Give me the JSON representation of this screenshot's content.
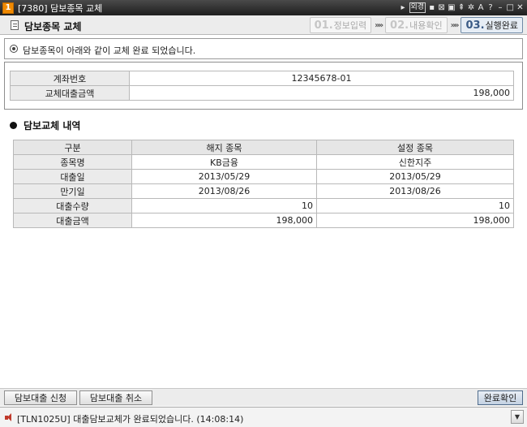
{
  "window": {
    "number": "1",
    "title": "[7380] 담보종목 교체",
    "icons": [
      "arrow-right-icon",
      "lock-label",
      "memo-icon",
      "close-box-icon",
      "window-icon",
      "pin-icon",
      "settings-icon",
      "font-icon",
      "help-icon",
      "minimize-icon",
      "maximize-icon",
      "close-icon"
    ],
    "lock_label": "외경",
    "font_label": "A",
    "help_label": "?"
  },
  "header": {
    "title": "담보종목 교체",
    "steps": [
      {
        "num": "01.",
        "label": "정보입력",
        "active": false
      },
      {
        "num": "02.",
        "label": "내용확인",
        "active": false
      },
      {
        "num": "03.",
        "label": "실행완료",
        "active": true
      }
    ],
    "separator": "»»"
  },
  "message": "담보종목이 아래와 같이 교체 완료 되었습니다.",
  "account": {
    "account_label": "계좌번호",
    "account_value": "12345678-01",
    "amount_label": "교체대출금액",
    "amount_value": "198,000"
  },
  "section_title": "담보교체 내역",
  "details": {
    "columns": [
      "구분",
      "해지 종목",
      "설정 종목"
    ],
    "rows": [
      {
        "label": "종목명",
        "cancel": "KB금융",
        "set": "신한지주",
        "align": "c"
      },
      {
        "label": "대출일",
        "cancel": "2013/05/29",
        "set": "2013/05/29",
        "align": "c"
      },
      {
        "label": "만기일",
        "cancel": "2013/08/26",
        "set": "2013/08/26",
        "align": "c"
      },
      {
        "label": "대출수량",
        "cancel": "10",
        "set": "10",
        "align": "r"
      },
      {
        "label": "대출금액",
        "cancel": "198,000",
        "set": "198,000",
        "align": "r"
      }
    ]
  },
  "buttons": {
    "apply": "담보대출 신청",
    "cancel": "담보대출 취소",
    "confirm": "완료확인"
  },
  "status": "[TLN1025U] 대출담보교체가 완료되었습니다. (14:08:14)",
  "status_dropdown": "▼"
}
